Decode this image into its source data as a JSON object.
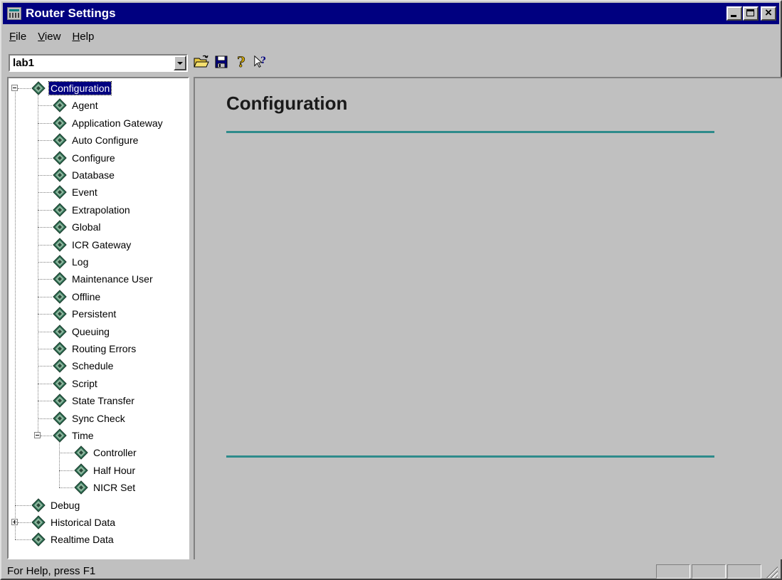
{
  "window": {
    "title": "Router Settings"
  },
  "menu": {
    "items": [
      {
        "label": "File",
        "accel": "F",
        "rest": "ile"
      },
      {
        "label": "View",
        "accel": "V",
        "rest": "iew"
      },
      {
        "label": "Help",
        "accel": "H",
        "rest": "elp"
      }
    ]
  },
  "toolbar": {
    "combo_value": "lab1",
    "icons": [
      "open-folder-icon",
      "save-disk-icon",
      "help-question-icon",
      "context-help-icon"
    ]
  },
  "tree": {
    "root_label": "Configuration",
    "children": [
      "Agent",
      "Application Gateway",
      "Auto Configure",
      "Configure",
      "Database",
      "Event",
      "Extrapolation",
      "Global",
      "ICR Gateway",
      "Log",
      "Maintenance User",
      "Offline",
      "Persistent",
      "Queuing",
      "Routing Errors",
      "Schedule",
      "Script",
      "State Transfer",
      "Sync Check"
    ],
    "time_label": "Time",
    "time_children": [
      "Controller",
      "Half Hour",
      "NICR Set"
    ],
    "top_level": [
      "Debug",
      "Historical Data",
      "Realtime Data"
    ]
  },
  "content": {
    "title": "Configuration"
  },
  "status": {
    "text": "For Help, press F1"
  },
  "colors": {
    "title_bar": "#000080",
    "rule": "#2e8b8b",
    "node_icon": "#2f6f55"
  }
}
